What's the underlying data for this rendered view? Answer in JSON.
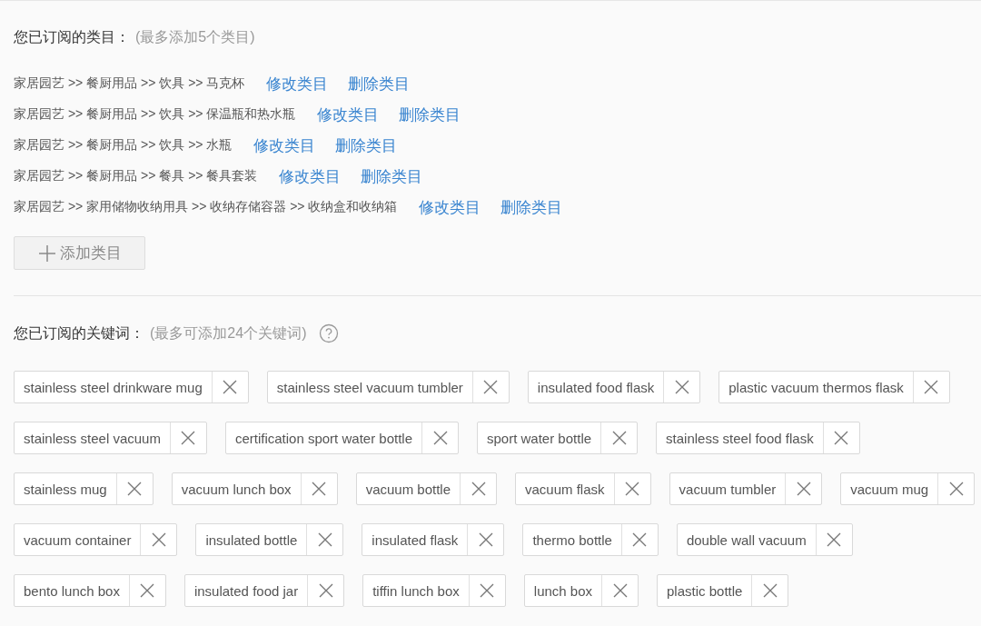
{
  "categories_section": {
    "title": "您已订阅的类目：",
    "hint": "(最多添加5个类目)",
    "categories": [
      {
        "path": "家居园艺 >> 餐厨用品 >> 饮具 >> 马克杯",
        "edit": "修改类目",
        "delete": "删除类目"
      },
      {
        "path": "家居园艺 >> 餐厨用品 >> 饮具 >> 保温瓶和热水瓶",
        "edit": "修改类目",
        "delete": "删除类目"
      },
      {
        "path": "家居园艺 >> 餐厨用品 >> 饮具 >> 水瓶",
        "edit": "修改类目",
        "delete": "删除类目"
      },
      {
        "path": "家居园艺 >> 餐厨用品 >> 餐具 >> 餐具套装",
        "edit": "修改类目",
        "delete": "删除类目"
      },
      {
        "path": "家居园艺 >> 家用储物收纳用具 >> 收纳存储容器 >> 收纳盒和收纳箱",
        "edit": "修改类目",
        "delete": "删除类目"
      }
    ],
    "add_button": {
      "label": "添加类目",
      "disabled": true
    }
  },
  "keywords_section": {
    "title": "您已订阅的关键词：",
    "hint": "(最多可添加24个关键词)",
    "keyword_rows": [
      [
        "stainless steel drinkware mug",
        "stainless steel vacuum tumbler",
        "insulated food flask",
        "plastic vacuum thermos flask"
      ],
      [
        "stainless steel vacuum",
        "certification sport water bottle",
        "sport water bottle",
        "stainless steel food flask"
      ],
      [
        "stainless mug",
        "vacuum lunch box",
        "vacuum bottle",
        "vacuum flask",
        "vacuum tumbler",
        "vacuum mug"
      ],
      [
        "vacuum container",
        "insulated bottle",
        "insulated flask",
        "thermo bottle",
        "double wall vacuum"
      ],
      [
        "bento lunch box",
        "insulated food jar",
        "tiffin lunch box",
        "lunch box",
        "plastic bottle"
      ]
    ]
  }
}
